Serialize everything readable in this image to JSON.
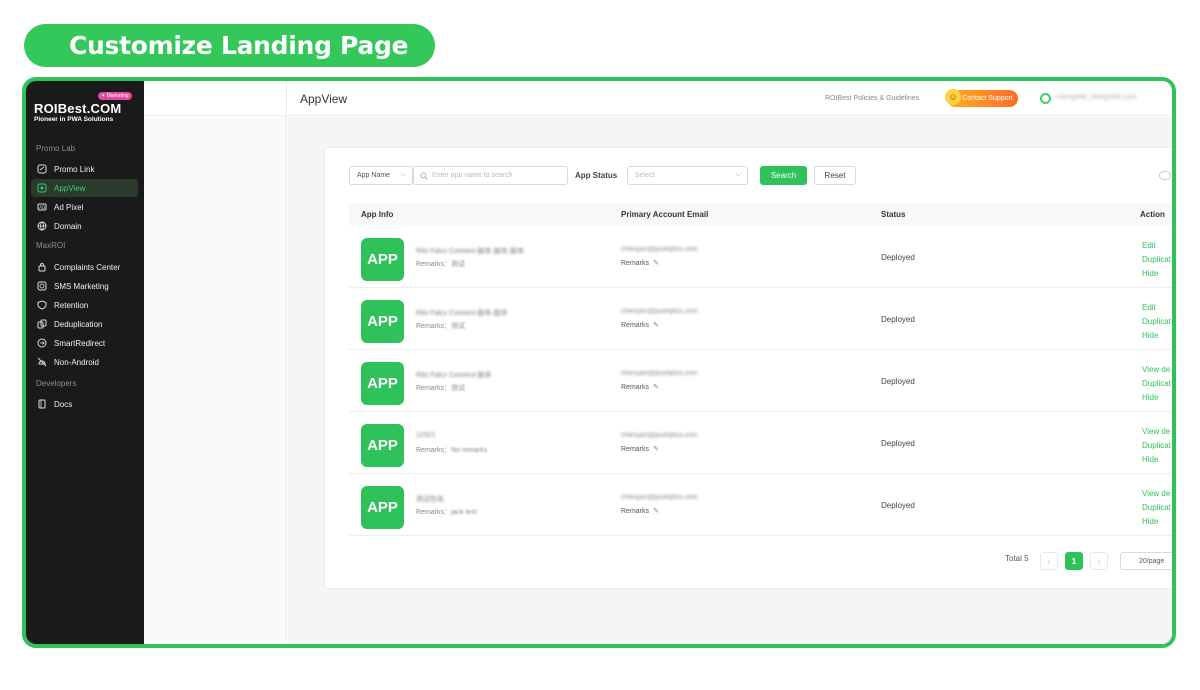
{
  "banner": {
    "title": "Customize Landing Page"
  },
  "brand": {
    "logo": "ROIBest.COM",
    "tagline": "Pioneer in PWA Solutions",
    "tag": "✦ Marketing"
  },
  "sidebar": {
    "sections": [
      {
        "label": "Promo Lab",
        "items": [
          {
            "label": "Promo Link",
            "icon": "link-icon"
          },
          {
            "label": "AppView",
            "icon": "app-icon",
            "active": true
          },
          {
            "label": "Ad Pixel",
            "icon": "ad-icon"
          },
          {
            "label": "Domain",
            "icon": "globe-icon"
          }
        ]
      },
      {
        "label": "MaxROI",
        "items": [
          {
            "label": "Complaints Center",
            "icon": "lock-icon"
          },
          {
            "label": "SMS Marketing",
            "icon": "message-icon"
          },
          {
            "label": "Retention",
            "icon": "shield-icon"
          },
          {
            "label": "Deduplication",
            "icon": "copy-icon"
          },
          {
            "label": "SmartRedirect",
            "icon": "redirect-icon"
          },
          {
            "label": "Non-Android",
            "icon": "android-off-icon"
          }
        ]
      },
      {
        "label": "Developers",
        "items": [
          {
            "label": "Docs",
            "icon": "doc-icon"
          }
        ]
      }
    ]
  },
  "header": {
    "title": "AppView",
    "policies": "ROIBest Policies & Guidelines",
    "contact": "Contact Support",
    "account": "cheng###_###@###.com"
  },
  "filters": {
    "field_select": "App Name",
    "search_placeholder": "Enter app name to search",
    "status_label": "App Status",
    "status_placeholder": "Select",
    "search_button": "Search",
    "reset_button": "Reset"
  },
  "table": {
    "columns": [
      "App Info",
      "Primary Account Email",
      "Status",
      "Action"
    ],
    "rows": [
      {
        "icon": "APP",
        "name": "Rito Falcz Connect-副本-副本-副本",
        "remarks_label": "Remarks：",
        "remarks": "测试",
        "email": "chenyan@pushplus.com",
        "email_remarks": "Remarks",
        "status": "Deployed",
        "actions": [
          "Edit",
          "Duplicat",
          "Hide"
        ]
      },
      {
        "icon": "APP",
        "name": "Rito Falcz Connect-副本-副本",
        "remarks_label": "Remarks：",
        "remarks": "测试",
        "email": "chenyan@pushplus.com",
        "email_remarks": "Remarks",
        "status": "Deployed",
        "actions": [
          "Edit",
          "Duplicat",
          "Hide"
        ]
      },
      {
        "icon": "APP",
        "name": "Rito Falcz Connect-副本",
        "remarks_label": "Remarks：",
        "remarks": "测试",
        "email": "chenyan@pushplus.com",
        "email_remarks": "Remarks",
        "status": "Deployed",
        "actions": [
          "View de",
          "Duplicat",
          "Hide"
        ]
      },
      {
        "icon": "APP",
        "name": "12321",
        "remarks_label": "Remarks：",
        "remarks": "No remarks",
        "email": "chenyan@pushplus.com",
        "email_remarks": "Remarks",
        "status": "Deployed",
        "actions": [
          "View de",
          "Duplicat",
          "Hide"
        ]
      },
      {
        "icon": "APP",
        "name": "测试包名",
        "remarks_label": "Remarks：",
        "remarks": "jack test",
        "email": "chenyan@pushplus.com",
        "email_remarks": "Remarks",
        "status": "Deployed",
        "actions": [
          "View de",
          "Duplicat",
          "Hide"
        ]
      }
    ]
  },
  "pagination": {
    "total": "Total 5",
    "prev": "‹",
    "current": "1",
    "next": "›",
    "page_size": "20/page"
  },
  "colors": {
    "accent": "#2fc25b",
    "sidebar_bg": "#1a1a1a"
  }
}
